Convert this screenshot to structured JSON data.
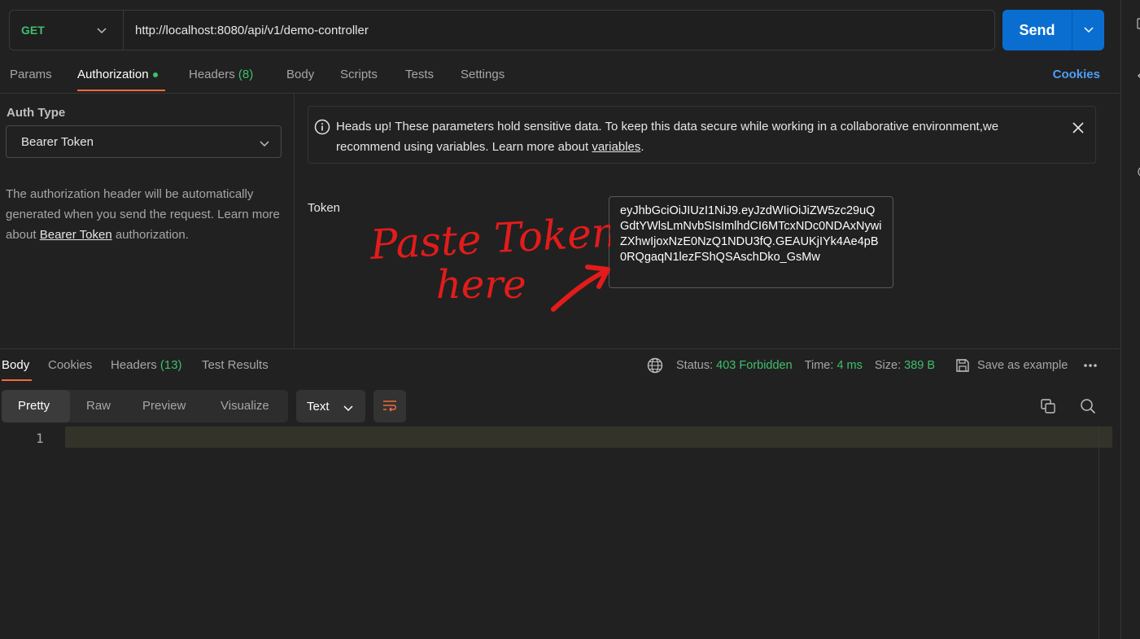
{
  "request": {
    "method": "GET",
    "url": "http://localhost:8080/api/v1/demo-controller",
    "send_label": "Send"
  },
  "tabs": {
    "params": "Params",
    "authorization": "Authorization",
    "headers_label": "Headers",
    "headers_count": "(8)",
    "body": "Body",
    "scripts": "Scripts",
    "tests": "Tests",
    "settings": "Settings",
    "cookies": "Cookies"
  },
  "auth": {
    "type_label": "Auth Type",
    "type_value": "Bearer Token",
    "desc_before": "The authorization header will be automatically generated when you send the request. Learn more about ",
    "desc_link": "Bearer Token",
    "desc_after": " authorization."
  },
  "alert": {
    "text_before": "Heads up! These parameters hold sensitive data. To keep this data secure while working in a collaborative environment,we recommend using variables. Learn more about ",
    "link": "variables",
    "text_after": "."
  },
  "token": {
    "label": "Token",
    "value": "eyJhbGciOiJIUzI1NiJ9.eyJzdWIiOiJiZW5zc29uQGdtYWlsLmNvbSIsImlhdCI6MTcxNDc0NDAxNywiZXhwIjoxNzE0NzQ1NDU3fQ.GEAUKjIYk4Ae4pB0RQgaqN1lezFShQSAschDko_GsMw"
  },
  "annotation": {
    "line1": "Paste Token",
    "line2": "here",
    "color": "#e31b1b"
  },
  "response": {
    "tabs": {
      "body": "Body",
      "cookies": "Cookies",
      "headers_label": "Headers",
      "headers_count": "(13)",
      "test_results": "Test Results"
    },
    "status_label": "Status:",
    "status_value": "403 Forbidden",
    "time_label": "Time:",
    "time_value": "4 ms",
    "size_label": "Size:",
    "size_value": "389 B",
    "save_label": "Save as example",
    "views": [
      "Pretty",
      "Raw",
      "Preview",
      "Visualize"
    ],
    "format": "Text",
    "line_number": "1"
  },
  "colors": {
    "accent": "#f26b3a",
    "success": "#3fbf6c",
    "primary": "#0a6ed1",
    "link": "#4d9ef7"
  }
}
